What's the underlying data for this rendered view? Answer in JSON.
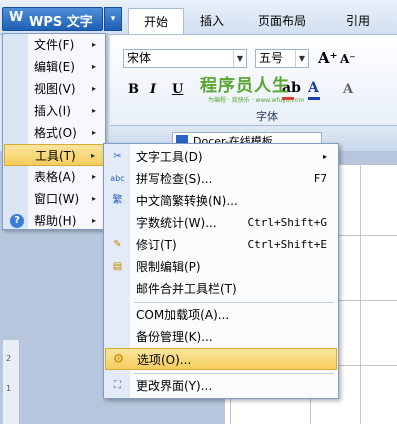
{
  "app": {
    "logo": "W",
    "title": "WPS 文字",
    "dropdown_glyph": "▾"
  },
  "tabs": [
    {
      "label": "开始",
      "active": true
    },
    {
      "label": "插入"
    },
    {
      "label": "页面布局"
    },
    {
      "label": "引用"
    }
  ],
  "ribbon": {
    "font_name": "宋体",
    "font_size": "五号",
    "grow_font": "A⁺",
    "shrink_font": "A⁻",
    "bold": "B",
    "italic": "I",
    "underline": "U",
    "highlight": "ab",
    "font_color": "A",
    "group_label": "字体",
    "more": "A",
    "watermark_big": "程序员人生",
    "watermark_small": "为编程 · 我快乐 · www.wfuyu.com"
  },
  "doc_tab": {
    "label": "Docer-在线模板"
  },
  "main_menu": {
    "items": [
      {
        "label": "文件(F)",
        "has_submenu": true
      },
      {
        "label": "编辑(E)",
        "has_submenu": true
      },
      {
        "label": "视图(V)",
        "has_submenu": true
      },
      {
        "label": "插入(I)",
        "has_submenu": true
      },
      {
        "label": "格式(O)",
        "has_submenu": true
      },
      {
        "label": "工具(T)",
        "has_submenu": true,
        "active": true
      },
      {
        "label": "表格(A)",
        "has_submenu": true
      },
      {
        "label": "窗口(W)",
        "has_submenu": true
      },
      {
        "label": "帮助(H)",
        "has_submenu": true
      }
    ],
    "submenu_arrow": "▸",
    "help_icon": "?"
  },
  "tools_menu": {
    "items": [
      {
        "label": "文字工具(D)",
        "shortcut": "",
        "has_submenu": true,
        "icon": "text-tools-icon"
      },
      {
        "label": "拼写检查(S)...",
        "shortcut": "F7",
        "icon": "spell-check-icon"
      },
      {
        "label": "中文简繁转换(N)...",
        "shortcut": "",
        "icon": "chinese-convert-icon"
      },
      {
        "label": "字数统计(W)...",
        "shortcut": "Ctrl+Shift+G",
        "icon": ""
      },
      {
        "label": "修订(T)",
        "shortcut": "Ctrl+Shift+E",
        "icon": "track-changes-icon"
      },
      {
        "label": "限制编辑(P)",
        "shortcut": "",
        "icon": "restrict-edit-icon"
      },
      {
        "label": "邮件合并工具栏(T)",
        "shortcut": "",
        "icon": ""
      },
      {
        "label": "COM加载项(A)...",
        "shortcut": "",
        "icon": ""
      },
      {
        "label": "备份管理(K)...",
        "shortcut": "",
        "icon": ""
      },
      {
        "label": "选项(O)...",
        "shortcut": "",
        "icon": "options-gear-icon",
        "active": true
      },
      {
        "label": "更改界面(Y)...",
        "shortcut": "",
        "icon": "change-ui-icon"
      }
    ],
    "icon_glyphs": {
      "abc": "abc",
      "spell_mark": "✓",
      "convert": "繁",
      "gear": "⚙",
      "shirt": "👕"
    }
  },
  "ruler": {
    "ticks": [
      "2",
      "1"
    ]
  },
  "colors": {
    "accent_blue": "#1e5fb6",
    "highlight_bg": "#f5cd5e",
    "highlight_color": "#e8322e",
    "font_color": "#1a3fa6",
    "watermark_green": "#5aa532"
  }
}
